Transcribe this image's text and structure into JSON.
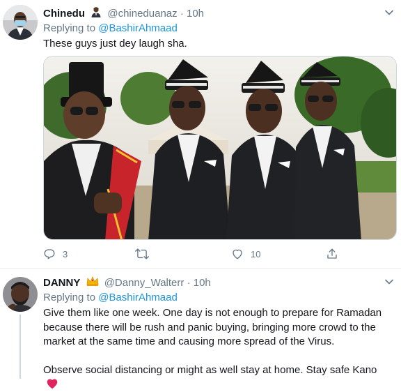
{
  "tweet1": {
    "name": "Chinedu",
    "name_emoji": "🧑🏿‍💼",
    "handle": "@chineduanaz",
    "separator": "·",
    "time": "10h",
    "replying_prefix": "Replying to",
    "replying_to": "@BashirAhmaad",
    "text": "These guys just dey laugh sha.",
    "media_icon": "pallbearers-photo",
    "actions": {
      "reply_count": "3",
      "retweet_count": "",
      "like_count": "10"
    }
  },
  "tweet2": {
    "name": "DANNY",
    "name_emoji": "👑",
    "handle": "@Danny_Walterr",
    "separator": "·",
    "time": "10h",
    "replying_prefix": "Replying to",
    "replying_to": "@BashirAhmaad",
    "paragraph1": "Give them like one week. One day is not enough to prepare for Ramadan because there will be rush and panic buying, bringing more crowd to the market at the same time and causing more spread of the Virus.",
    "paragraph2": "Observe social distancing or might as well stay at home. Stay safe Kano",
    "heart_emoji_color": "#e0245e"
  },
  "colors": {
    "link": "#1b95e0",
    "secondary_text": "#657786",
    "divider": "#e6ecf0"
  }
}
